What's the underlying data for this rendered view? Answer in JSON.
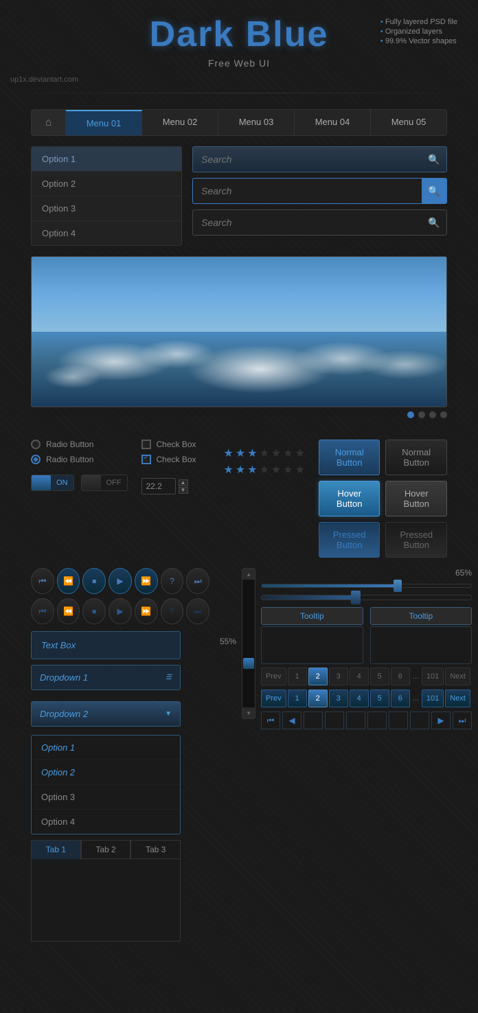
{
  "header": {
    "title_dark": "Dark",
    "title_blue": "Blue",
    "subtitle": "Free Web UI",
    "features": [
      "Fully layered PSD file",
      "Organized layers",
      "99.9% Vector shapes"
    ],
    "author": "up1x.deviantart.com"
  },
  "nav": {
    "home_icon": "⌂",
    "items": [
      {
        "label": "Menu 01",
        "active": true
      },
      {
        "label": "Menu 02",
        "active": false
      },
      {
        "label": "Menu 03",
        "active": false
      },
      {
        "label": "Menu 04",
        "active": false
      },
      {
        "label": "Menu 05",
        "active": false
      }
    ]
  },
  "dropdown": {
    "options": [
      {
        "label": "Option 1",
        "selected": true
      },
      {
        "label": "Option 2",
        "selected": false
      },
      {
        "label": "Option 3",
        "selected": false
      },
      {
        "label": "Option 4",
        "selected": false
      }
    ]
  },
  "search": {
    "items": [
      {
        "placeholder": "Search",
        "style": "style1"
      },
      {
        "placeholder": "Search",
        "style": "style2"
      },
      {
        "placeholder": "Search",
        "style": "style3"
      }
    ]
  },
  "slider": {
    "dots": 4,
    "active_dot": 0
  },
  "radio_buttons": [
    {
      "label": "Radio Button",
      "active": false
    },
    {
      "label": "Radio Button",
      "active": true
    }
  ],
  "checkboxes": [
    {
      "label": "Check Box",
      "active": false
    },
    {
      "label": "Check Box",
      "active": true
    }
  ],
  "buttons": {
    "normal": "Normal Button",
    "hover": "Hover Button",
    "pressed": "Pressed Button"
  },
  "toggle": {
    "on_label": "ON",
    "off_label": "OFF"
  },
  "spinner": {
    "value": "22.2"
  },
  "stars": {
    "row1": [
      true,
      true,
      true,
      false,
      false,
      false,
      false
    ],
    "row2": [
      true,
      true,
      true,
      false,
      false,
      false,
      false
    ]
  },
  "media_controls": {
    "row1": [
      "⏮",
      "⏪",
      "⏹",
      "▶",
      "⏩",
      "?",
      "⏭"
    ],
    "row2": [
      "⏮",
      "⏪",
      "⏹",
      "▶",
      "⏩",
      "?",
      "⏭"
    ]
  },
  "text_box": {
    "placeholder": "Text Box",
    "value": "Text Box"
  },
  "dropdowns": {
    "dd1_label": "Dropdown 1",
    "dd2_label": "Dropdown 2",
    "options": [
      {
        "label": "Option 1"
      },
      {
        "label": "Option 2"
      },
      {
        "label": "Option 3"
      },
      {
        "label": "Option 4"
      }
    ]
  },
  "tabs": {
    "items": [
      {
        "label": "Tab 1",
        "active": true
      },
      {
        "label": "Tab 2",
        "active": false
      },
      {
        "label": "Tab 3",
        "active": false
      }
    ]
  },
  "sliders": {
    "vertical_label": "55%",
    "horizontal_label": "65%",
    "h_fill_percent": 65,
    "h2_fill_percent": 45
  },
  "tooltips": [
    {
      "label": "Tooltip"
    },
    {
      "label": "Tooltip"
    }
  ],
  "pagination": {
    "row1": {
      "prev": "Prev",
      "pages": [
        "1",
        "2",
        "3",
        "4",
        "5",
        "6"
      ],
      "ellipsis": "...",
      "last": "101",
      "next": "Next",
      "active": "2"
    },
    "row2": {
      "prev": "Prev",
      "pages": [
        "1",
        "2",
        "3",
        "4",
        "5",
        "6"
      ],
      "ellipsis": "...",
      "last": "101",
      "next": "Next",
      "active": "2"
    }
  }
}
